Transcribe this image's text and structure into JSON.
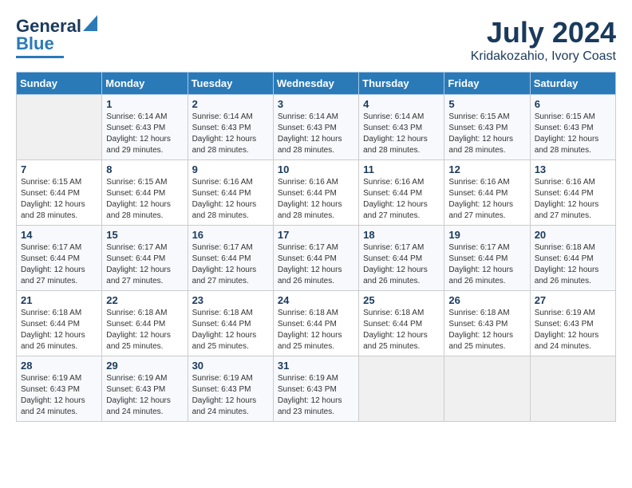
{
  "header": {
    "logo_general": "General",
    "logo_blue": "Blue",
    "month_title": "July 2024",
    "location": "Kridakozahio, Ivory Coast"
  },
  "weekdays": [
    "Sunday",
    "Monday",
    "Tuesday",
    "Wednesday",
    "Thursday",
    "Friday",
    "Saturday"
  ],
  "weeks": [
    [
      {
        "day": "",
        "info": ""
      },
      {
        "day": "1",
        "info": "Sunrise: 6:14 AM\nSunset: 6:43 PM\nDaylight: 12 hours\nand 29 minutes."
      },
      {
        "day": "2",
        "info": "Sunrise: 6:14 AM\nSunset: 6:43 PM\nDaylight: 12 hours\nand 28 minutes."
      },
      {
        "day": "3",
        "info": "Sunrise: 6:14 AM\nSunset: 6:43 PM\nDaylight: 12 hours\nand 28 minutes."
      },
      {
        "day": "4",
        "info": "Sunrise: 6:14 AM\nSunset: 6:43 PM\nDaylight: 12 hours\nand 28 minutes."
      },
      {
        "day": "5",
        "info": "Sunrise: 6:15 AM\nSunset: 6:43 PM\nDaylight: 12 hours\nand 28 minutes."
      },
      {
        "day": "6",
        "info": "Sunrise: 6:15 AM\nSunset: 6:43 PM\nDaylight: 12 hours\nand 28 minutes."
      }
    ],
    [
      {
        "day": "7",
        "info": "Sunrise: 6:15 AM\nSunset: 6:44 PM\nDaylight: 12 hours\nand 28 minutes."
      },
      {
        "day": "8",
        "info": "Sunrise: 6:15 AM\nSunset: 6:44 PM\nDaylight: 12 hours\nand 28 minutes."
      },
      {
        "day": "9",
        "info": "Sunrise: 6:16 AM\nSunset: 6:44 PM\nDaylight: 12 hours\nand 28 minutes."
      },
      {
        "day": "10",
        "info": "Sunrise: 6:16 AM\nSunset: 6:44 PM\nDaylight: 12 hours\nand 28 minutes."
      },
      {
        "day": "11",
        "info": "Sunrise: 6:16 AM\nSunset: 6:44 PM\nDaylight: 12 hours\nand 27 minutes."
      },
      {
        "day": "12",
        "info": "Sunrise: 6:16 AM\nSunset: 6:44 PM\nDaylight: 12 hours\nand 27 minutes."
      },
      {
        "day": "13",
        "info": "Sunrise: 6:16 AM\nSunset: 6:44 PM\nDaylight: 12 hours\nand 27 minutes."
      }
    ],
    [
      {
        "day": "14",
        "info": "Sunrise: 6:17 AM\nSunset: 6:44 PM\nDaylight: 12 hours\nand 27 minutes."
      },
      {
        "day": "15",
        "info": "Sunrise: 6:17 AM\nSunset: 6:44 PM\nDaylight: 12 hours\nand 27 minutes."
      },
      {
        "day": "16",
        "info": "Sunrise: 6:17 AM\nSunset: 6:44 PM\nDaylight: 12 hours\nand 27 minutes."
      },
      {
        "day": "17",
        "info": "Sunrise: 6:17 AM\nSunset: 6:44 PM\nDaylight: 12 hours\nand 26 minutes."
      },
      {
        "day": "18",
        "info": "Sunrise: 6:17 AM\nSunset: 6:44 PM\nDaylight: 12 hours\nand 26 minutes."
      },
      {
        "day": "19",
        "info": "Sunrise: 6:17 AM\nSunset: 6:44 PM\nDaylight: 12 hours\nand 26 minutes."
      },
      {
        "day": "20",
        "info": "Sunrise: 6:18 AM\nSunset: 6:44 PM\nDaylight: 12 hours\nand 26 minutes."
      }
    ],
    [
      {
        "day": "21",
        "info": "Sunrise: 6:18 AM\nSunset: 6:44 PM\nDaylight: 12 hours\nand 26 minutes."
      },
      {
        "day": "22",
        "info": "Sunrise: 6:18 AM\nSunset: 6:44 PM\nDaylight: 12 hours\nand 25 minutes."
      },
      {
        "day": "23",
        "info": "Sunrise: 6:18 AM\nSunset: 6:44 PM\nDaylight: 12 hours\nand 25 minutes."
      },
      {
        "day": "24",
        "info": "Sunrise: 6:18 AM\nSunset: 6:44 PM\nDaylight: 12 hours\nand 25 minutes."
      },
      {
        "day": "25",
        "info": "Sunrise: 6:18 AM\nSunset: 6:44 PM\nDaylight: 12 hours\nand 25 minutes."
      },
      {
        "day": "26",
        "info": "Sunrise: 6:18 AM\nSunset: 6:43 PM\nDaylight: 12 hours\nand 25 minutes."
      },
      {
        "day": "27",
        "info": "Sunrise: 6:19 AM\nSunset: 6:43 PM\nDaylight: 12 hours\nand 24 minutes."
      }
    ],
    [
      {
        "day": "28",
        "info": "Sunrise: 6:19 AM\nSunset: 6:43 PM\nDaylight: 12 hours\nand 24 minutes."
      },
      {
        "day": "29",
        "info": "Sunrise: 6:19 AM\nSunset: 6:43 PM\nDaylight: 12 hours\nand 24 minutes."
      },
      {
        "day": "30",
        "info": "Sunrise: 6:19 AM\nSunset: 6:43 PM\nDaylight: 12 hours\nand 24 minutes."
      },
      {
        "day": "31",
        "info": "Sunrise: 6:19 AM\nSunset: 6:43 PM\nDaylight: 12 hours\nand 23 minutes."
      },
      {
        "day": "",
        "info": ""
      },
      {
        "day": "",
        "info": ""
      },
      {
        "day": "",
        "info": ""
      }
    ]
  ]
}
